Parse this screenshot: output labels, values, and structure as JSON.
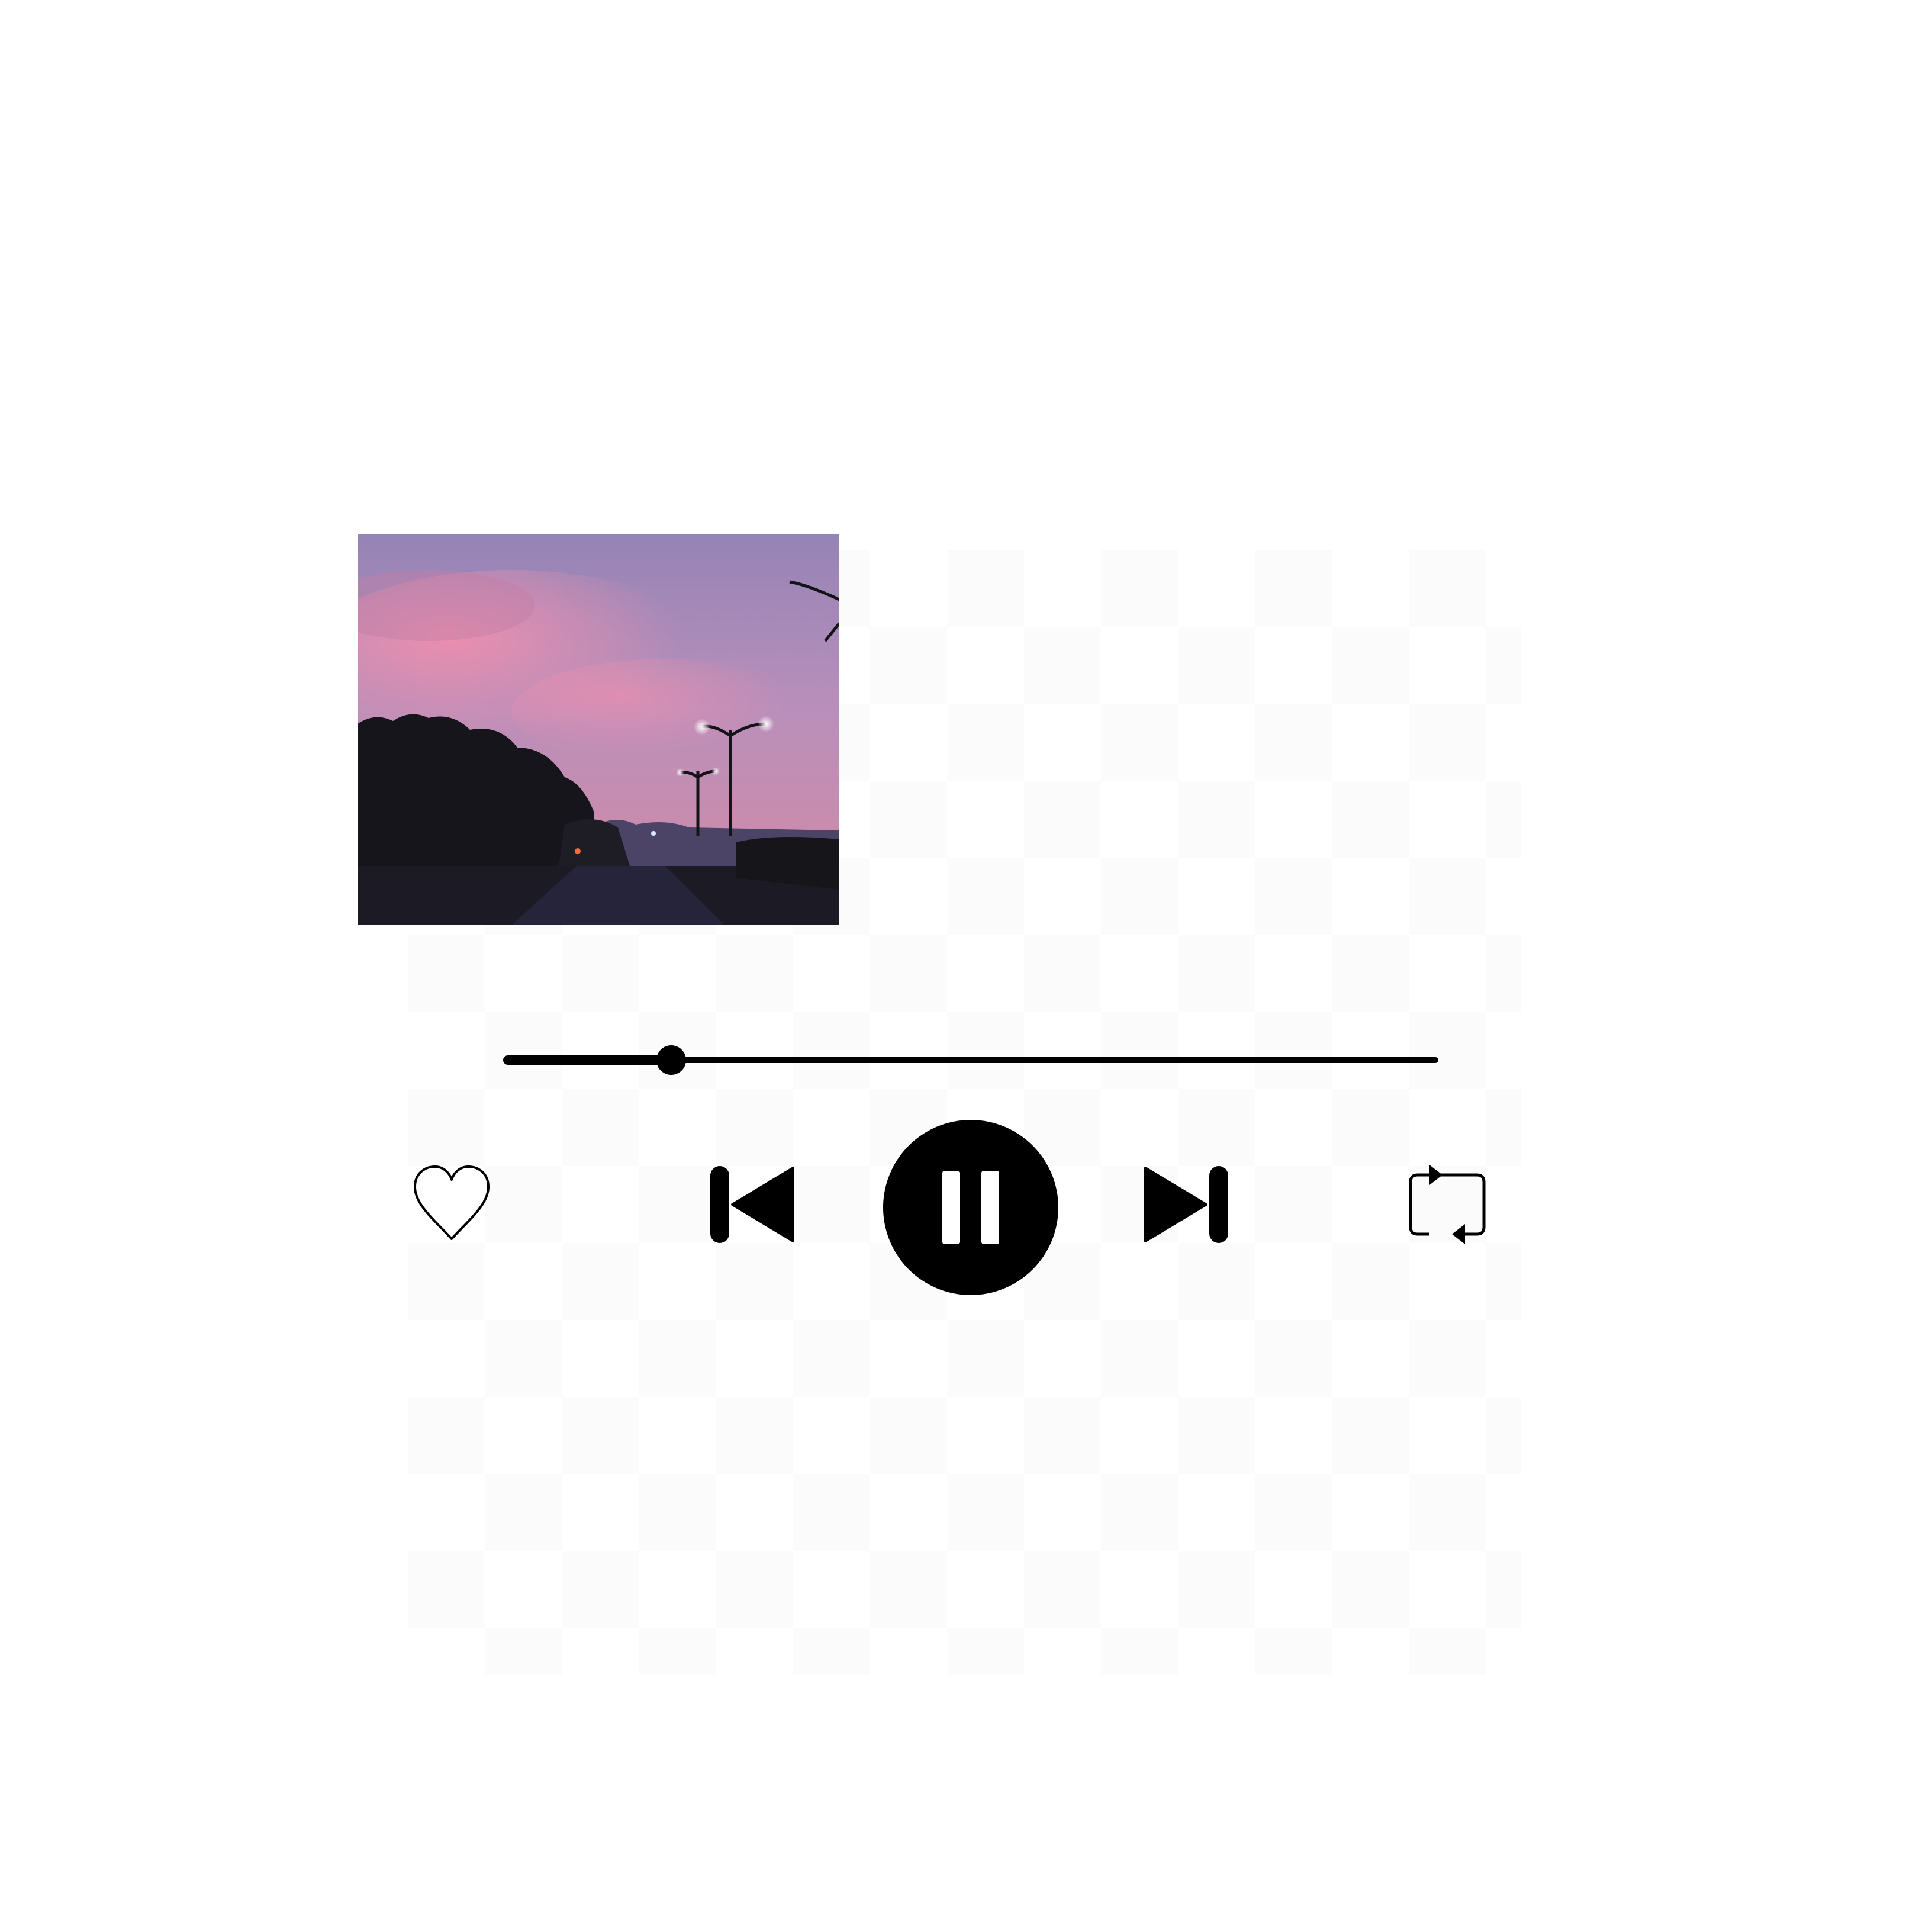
{
  "player": {
    "album_art": {
      "description_icon": "album-cover-image",
      "colors": {
        "sky_top": "#9a86b8",
        "sky_pink": "#e38aa8",
        "ground": "#1b1a24"
      }
    },
    "progress": {
      "fraction": 0.18
    },
    "controls": {
      "like": {
        "icon": "heart-outline-icon"
      },
      "previous": {
        "icon": "skip-previous-icon"
      },
      "play_pause": {
        "icon": "pause-icon",
        "state": "playing"
      },
      "next": {
        "icon": "skip-next-icon"
      },
      "repeat": {
        "icon": "repeat-icon"
      }
    },
    "colors": {
      "foreground": "#000000",
      "background": "#ffffff"
    }
  }
}
